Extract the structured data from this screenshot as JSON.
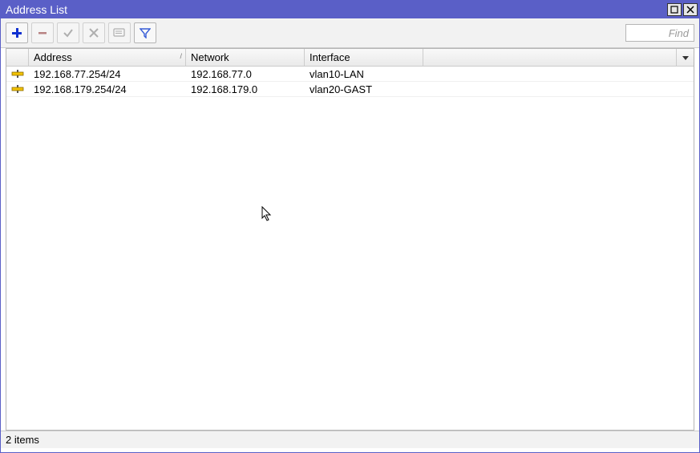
{
  "window": {
    "title": "Address List"
  },
  "toolbar": {
    "add_icon": "plus-icon",
    "remove_icon": "minus-icon",
    "enable_icon": "check-icon",
    "disable_icon": "x-icon",
    "comment_icon": "note-icon",
    "filter_icon": "funnel-icon",
    "find_placeholder": "Find"
  },
  "columns": {
    "flag": "",
    "address": "Address",
    "network": "Network",
    "interface": "Interface"
  },
  "rows": [
    {
      "address": "192.168.77.254/24",
      "network": "192.168.77.0",
      "interface": "vlan10-LAN"
    },
    {
      "address": "192.168.179.254/24",
      "network": "192.168.179.0",
      "interface": "vlan20-GAST"
    }
  ],
  "status": {
    "text": "2 items"
  }
}
